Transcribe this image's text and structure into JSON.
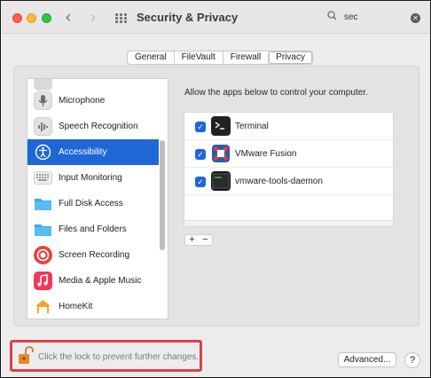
{
  "window": {
    "title": "Security & Privacy",
    "back_glyph": "‹",
    "forward_glyph": "›"
  },
  "search": {
    "value": "sec",
    "clear_glyph": "✕",
    "icon": "search-icon"
  },
  "tabs": [
    {
      "label": "General",
      "active": false
    },
    {
      "label": "FileVault",
      "active": false
    },
    {
      "label": "Firewall",
      "active": false
    },
    {
      "label": "Privacy",
      "active": true
    }
  ],
  "sidebar": {
    "items": [
      {
        "label": "Microphone",
        "icon": "microphone-icon",
        "selected": false
      },
      {
        "label": "Speech Recognition",
        "icon": "speech-recognition-icon",
        "selected": false
      },
      {
        "label": "Accessibility",
        "icon": "accessibility-icon",
        "selected": true
      },
      {
        "label": "Input Monitoring",
        "icon": "keyboard-icon",
        "selected": false
      },
      {
        "label": "Full Disk Access",
        "icon": "folder-icon",
        "selected": false
      },
      {
        "label": "Files and Folders",
        "icon": "folder-icon",
        "selected": false
      },
      {
        "label": "Screen Recording",
        "icon": "screen-recording-icon",
        "selected": false
      },
      {
        "label": "Media & Apple Music",
        "icon": "music-icon",
        "selected": false
      },
      {
        "label": "HomeKit",
        "icon": "home-icon",
        "selected": false
      }
    ]
  },
  "privacy": {
    "description": "Allow the apps below to control your computer.",
    "apps": [
      {
        "name": "Terminal",
        "checked": true,
        "icon": "terminal-icon"
      },
      {
        "name": "VMware Fusion",
        "checked": true,
        "icon": "vmware-fusion-icon"
      },
      {
        "name": "vmware-tools-daemon",
        "checked": true,
        "icon": "exec-icon"
      }
    ],
    "add_label": "+",
    "remove_label": "−"
  },
  "footer": {
    "lock_text": "Click the lock to prevent further changes.",
    "advanced_label": "Advanced...",
    "help_label": "?"
  },
  "colors": {
    "accent": "#1f66d6",
    "highlight_box": "#d9424d"
  }
}
